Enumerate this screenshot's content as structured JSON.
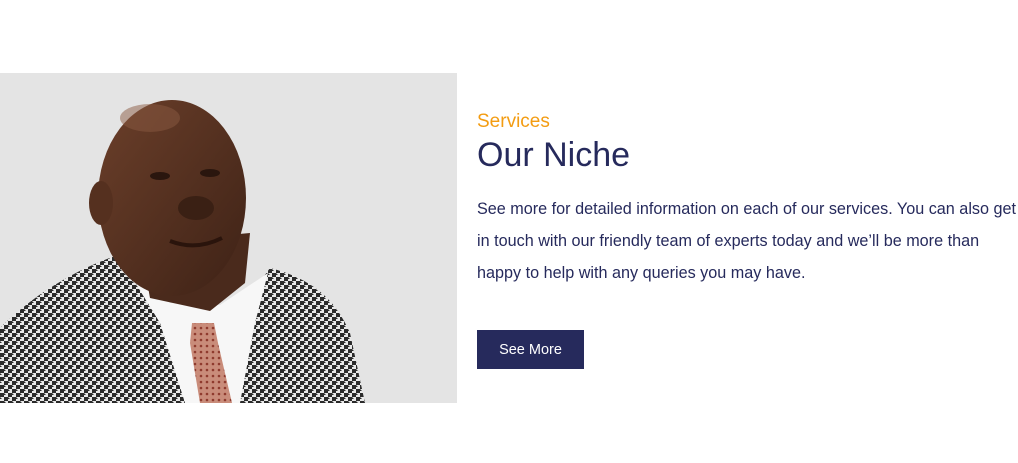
{
  "niche": {
    "photo_label": "Portrait of a man in a houndstooth jacket and tie",
    "eyebrow": "Services",
    "title": "Our Niche",
    "description": "See more for detailed information on each of our services. You can also get in touch with our friendly team of experts today and we’ll be more than happy to help with any queries you may have.",
    "button_label": "See More"
  },
  "colors": {
    "accent": "#f39c12",
    "navy": "#262a5c",
    "photo_bg": "#e6e6e6"
  }
}
